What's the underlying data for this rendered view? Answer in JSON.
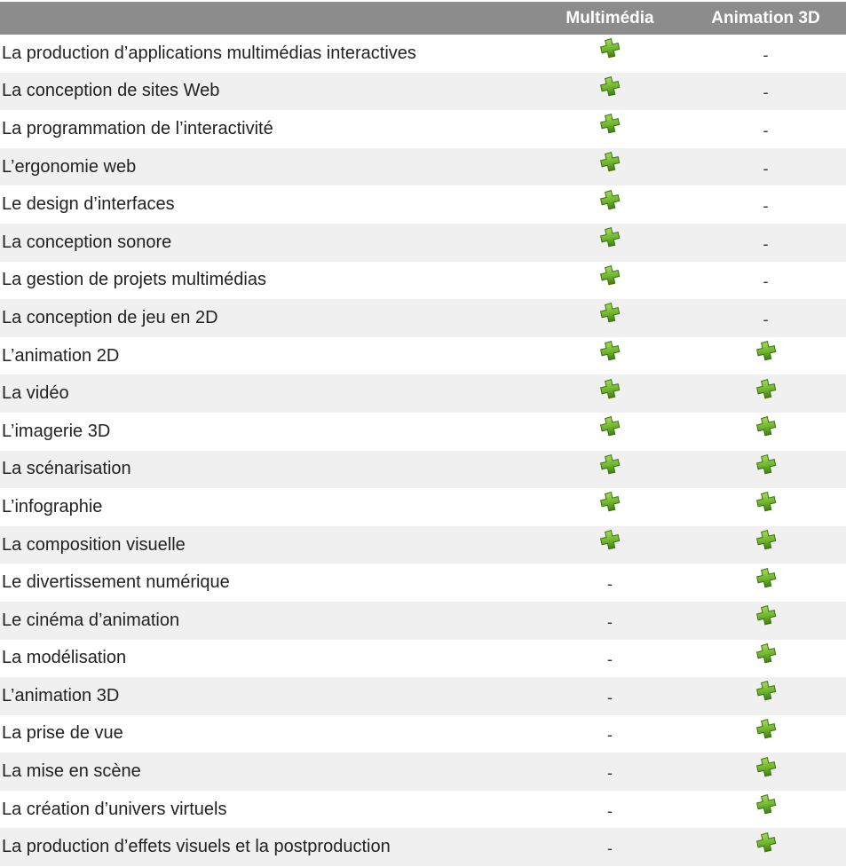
{
  "header": {
    "label_col": "",
    "col1": "Multimédia",
    "col2": "Animation 3D"
  },
  "icons": {
    "check": "green-plus-icon",
    "none": "-"
  },
  "colors": {
    "header_bg": "#8c8c8c",
    "row_alt": "#f0f0f0",
    "plus_green": "#6fb52c"
  },
  "rows": [
    {
      "label": "La production d’applications multimédias interactives",
      "multimedia": true,
      "animation3d": false
    },
    {
      "label": "La conception de sites Web",
      "multimedia": true,
      "animation3d": false
    },
    {
      "label": "La programmation de l’interactivité",
      "multimedia": true,
      "animation3d": false
    },
    {
      "label": "L’ergonomie web",
      "multimedia": true,
      "animation3d": false
    },
    {
      "label": "Le design d’interfaces",
      "multimedia": true,
      "animation3d": false
    },
    {
      "label": "La conception sonore",
      "multimedia": true,
      "animation3d": false
    },
    {
      "label": "La gestion de projets multimédias",
      "multimedia": true,
      "animation3d": false
    },
    {
      "label": "La conception de jeu en 2D",
      "multimedia": true,
      "animation3d": false
    },
    {
      "label": "L’animation 2D",
      "multimedia": true,
      "animation3d": true
    },
    {
      "label": "La vidéo",
      "multimedia": true,
      "animation3d": true
    },
    {
      "label": "L’imagerie 3D",
      "multimedia": true,
      "animation3d": true
    },
    {
      "label": "La scénarisation",
      "multimedia": true,
      "animation3d": true
    },
    {
      "label": "L’infographie",
      "multimedia": true,
      "animation3d": true
    },
    {
      "label": "La composition visuelle",
      "multimedia": true,
      "animation3d": true
    },
    {
      "label": "Le divertissement numérique",
      "multimedia": false,
      "animation3d": true
    },
    {
      "label": "Le cinéma d’animation",
      "multimedia": false,
      "animation3d": true
    },
    {
      "label": "La modélisation",
      "multimedia": false,
      "animation3d": true
    },
    {
      "label": "L’animation 3D",
      "multimedia": false,
      "animation3d": true
    },
    {
      "label": "La prise de vue",
      "multimedia": false,
      "animation3d": true
    },
    {
      "label": "La mise en scène",
      "multimedia": false,
      "animation3d": true
    },
    {
      "label": "La création d’univers virtuels",
      "multimedia": false,
      "animation3d": true
    },
    {
      "label": "La production d’effets visuels et la postproduction",
      "multimedia": false,
      "animation3d": true
    }
  ]
}
